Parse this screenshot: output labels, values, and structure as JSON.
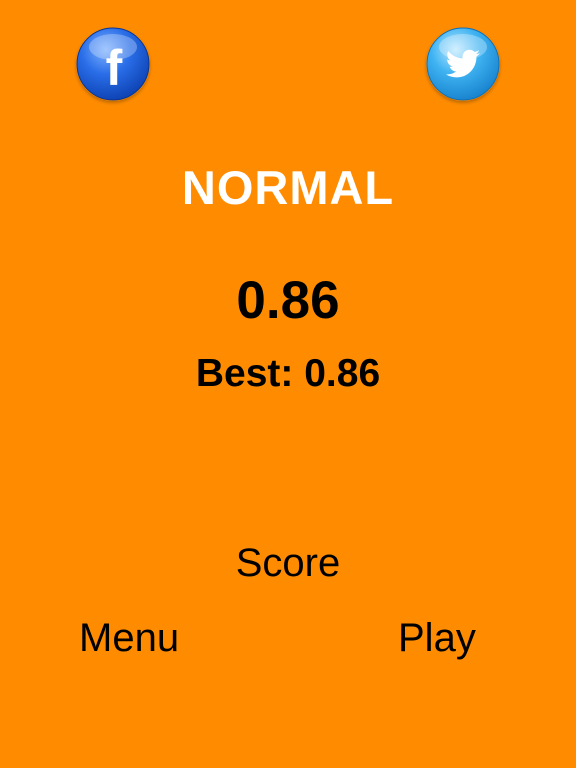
{
  "background_color": "#FF8C00",
  "social": {
    "facebook": {
      "icon": "facebook-icon",
      "letter": "f",
      "color": "#1E63E0"
    },
    "twitter": {
      "icon": "twitter-icon",
      "color": "#2FA9F0"
    }
  },
  "mode": "NORMAL",
  "result": {
    "score": "0.86",
    "best_label": "Best:",
    "best_value": "0.86"
  },
  "buttons": {
    "score": "Score",
    "menu": "Menu",
    "play": "Play"
  }
}
